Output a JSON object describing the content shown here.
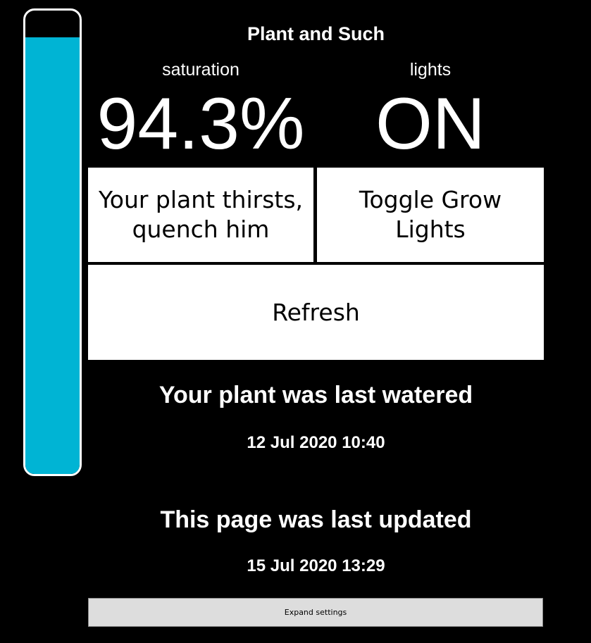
{
  "app": {
    "title": "Plant and Such"
  },
  "saturation": {
    "label": "saturation",
    "value_text": "94.3%",
    "fill_fraction": 0.943,
    "fill_color": "#00b4d4"
  },
  "lights": {
    "label": "lights",
    "value_text": "ON"
  },
  "buttons": {
    "water": [
      "Your plant thirsts,",
      "quench him"
    ],
    "toggle_lights": [
      "Toggle Grow",
      "Lights"
    ],
    "refresh": "Refresh"
  },
  "last_watered": {
    "heading": "Your plant was last watered",
    "timestamp": "12 Jul 2020 10:40"
  },
  "last_updated": {
    "heading": "This page was last updated",
    "timestamp": "15 Jul 2020 13:29"
  },
  "settings": {
    "expand_label": "Expand settings"
  }
}
